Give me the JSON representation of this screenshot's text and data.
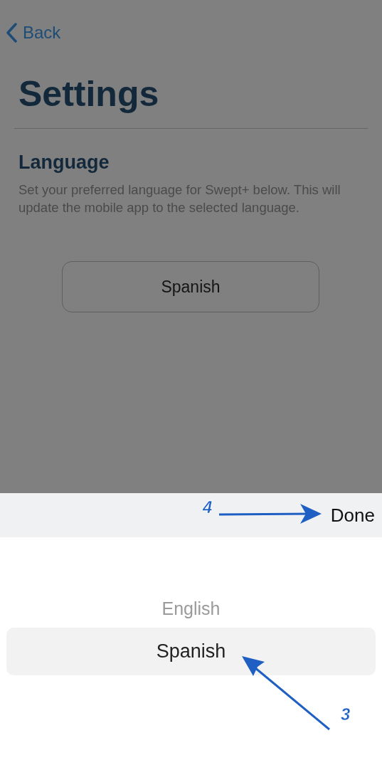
{
  "nav": {
    "back": "Back"
  },
  "title": "Settings",
  "section": {
    "heading": "Language",
    "description": "Set your preferred language for Swept+ below. This will update the mobile app to the selected language.",
    "selector_value": "Spanish"
  },
  "picker": {
    "done": "Done",
    "options": [
      {
        "label": "English",
        "selected": false
      },
      {
        "label": "Spanish",
        "selected": true
      }
    ]
  },
  "annotations": [
    {
      "label": "4",
      "kind": "right"
    },
    {
      "label": "3",
      "kind": "up-left"
    }
  ]
}
